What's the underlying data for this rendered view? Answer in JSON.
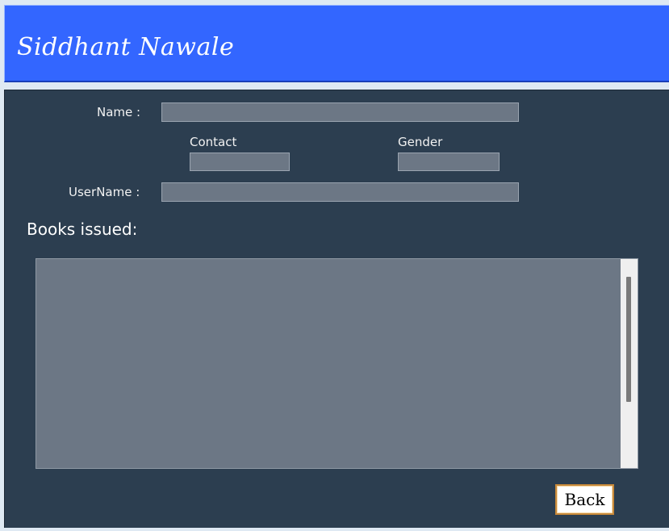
{
  "header": {
    "title": "Siddhant Nawale"
  },
  "form": {
    "name_label": "Name :",
    "name_value": "",
    "contact_label": "Contact",
    "contact_value": "",
    "gender_label": "Gender",
    "gender_value": "",
    "username_label": "UserName :",
    "username_value": ""
  },
  "books": {
    "title": "Books issued:",
    "items": []
  },
  "actions": {
    "back_label": "Back"
  },
  "colors": {
    "header_bg": "#3366ff",
    "panel_bg": "#2c3e50",
    "field_bg": "#6c7785",
    "button_border": "#c8893a"
  }
}
